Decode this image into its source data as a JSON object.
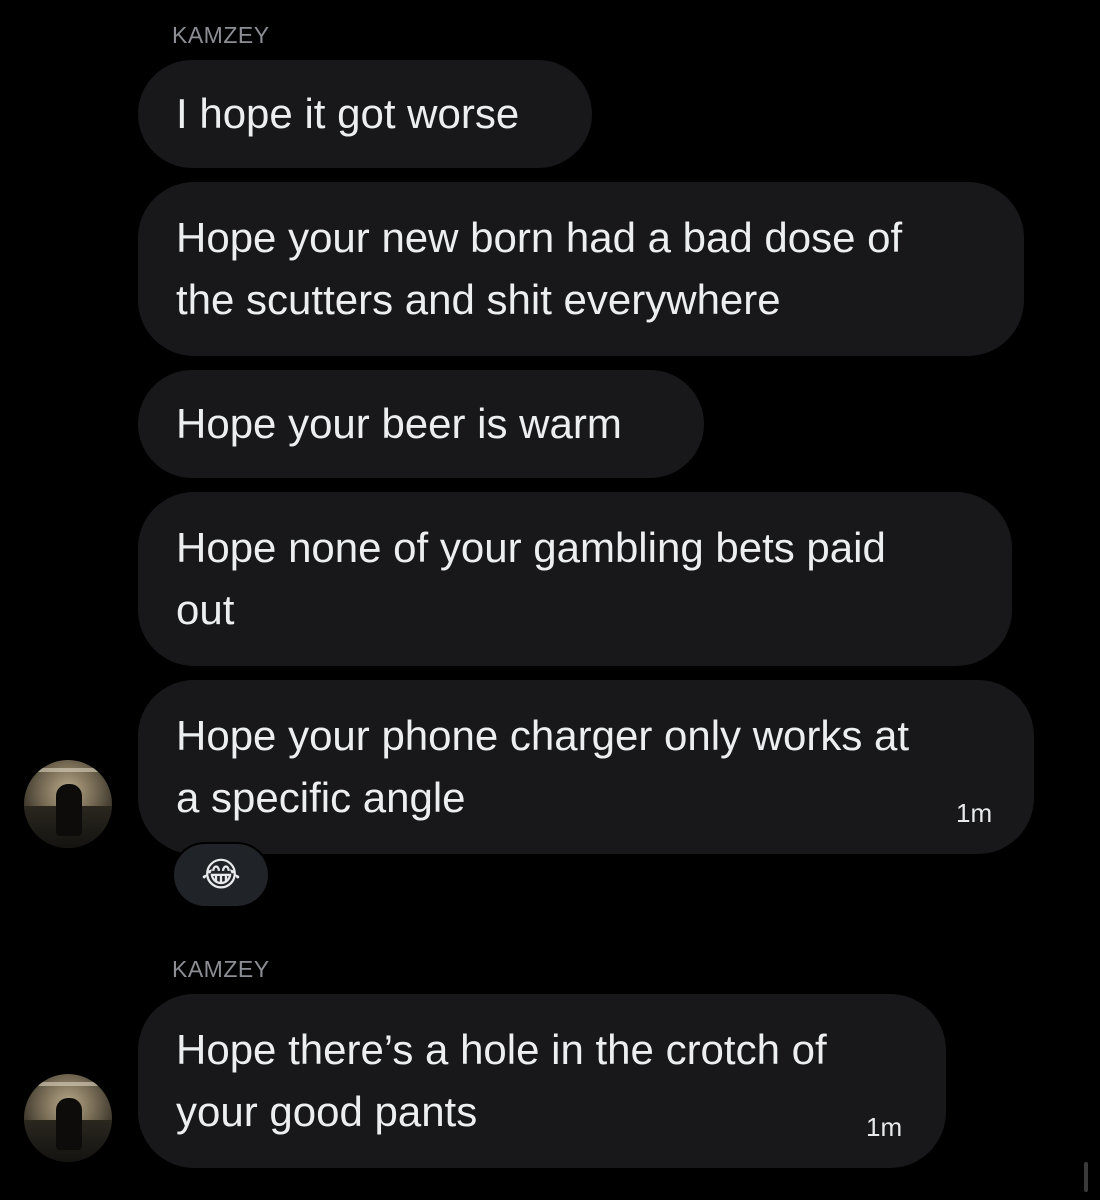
{
  "groups": [
    {
      "sender": "KAMZEY",
      "messages": [
        {
          "text": "I hope it got worse"
        },
        {
          "text": "Hope your new born had a bad dose of\nthe scutters and shit everywhere"
        },
        {
          "text": "Hope your beer is warm"
        },
        {
          "text": "Hope none of your gambling bets paid\nout"
        },
        {
          "text": "Hope your phone charger only works at\na specific angle",
          "time": "1m"
        }
      ],
      "reaction": "😂"
    },
    {
      "sender": "KAMZEY",
      "messages": [
        {
          "text": "Hope there’s a hole in the crotch of\nyour good pants",
          "time": "1m"
        }
      ]
    }
  ],
  "colors": {
    "background": "#000000",
    "bubble": "#18181b",
    "text": "#eceef0",
    "sender": "#8b8f94"
  },
  "icons": {
    "avatar": "avatar-photo-icon",
    "reaction": "laughing-tears-emoji-icon"
  }
}
